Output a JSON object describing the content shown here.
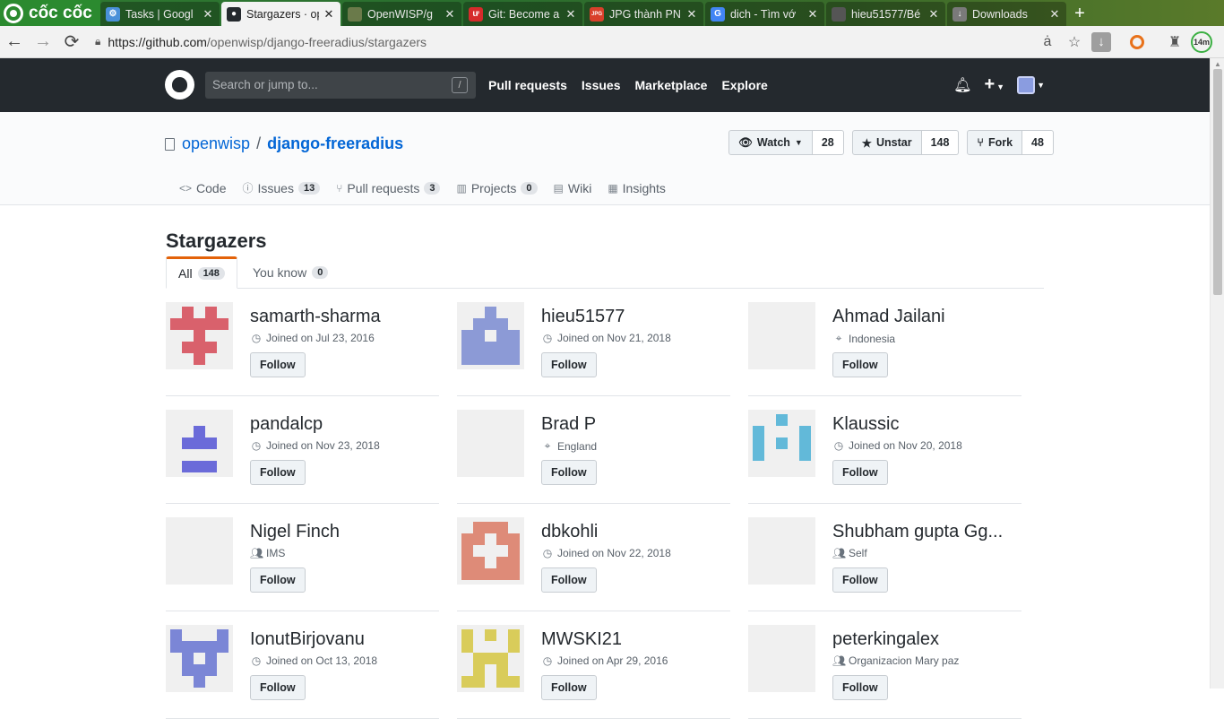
{
  "browser": {
    "brand": "cốc cốc",
    "tabs": [
      {
        "title": "Tasks | Googl",
        "fav_color": "#4a90d9",
        "fav_text": "⚙",
        "active": false
      },
      {
        "title": "Stargazers · op",
        "fav_color": "#24292e",
        "fav_text": "●",
        "active": true
      },
      {
        "title": "OpenWISP/g",
        "fav_color": "#6a7a4a",
        "fav_text": "",
        "active": false
      },
      {
        "title": "Git: Become a",
        "fav_color": "#d62b2b",
        "fav_text": "ư",
        "active": false
      },
      {
        "title": "JPG thành PN",
        "fav_color": "#d9402b",
        "fav_text": "JPG",
        "active": false
      },
      {
        "title": "dich - Tìm vớ",
        "fav_color": "#4285f4",
        "fav_text": "G",
        "active": false
      },
      {
        "title": "hieu51577/Bé",
        "fav_color": "#555555",
        "fav_text": "",
        "active": false
      },
      {
        "title": "Downloads",
        "fav_color": "#7a7a7a",
        "fav_text": "↓",
        "active": false
      }
    ],
    "url_host": "https://github.com",
    "url_path": "/openwisp/django-freeradius/stargazers",
    "translate_glyph": "ȧ",
    "timer_label": "14m"
  },
  "gh": {
    "search_placeholder": "Search or jump to...",
    "search_key": "/",
    "nav": [
      "Pull requests",
      "Issues",
      "Marketplace",
      "Explore"
    ]
  },
  "repo": {
    "owner": "openwisp",
    "separator": "/",
    "name": "django-freeradius",
    "watch_label": "Watch",
    "watch_count": "28",
    "star_label": "Unstar",
    "star_count": "148",
    "fork_label": "Fork",
    "fork_count": "48",
    "nav": [
      {
        "label": "Code",
        "icon": "<>",
        "count": ""
      },
      {
        "label": "Issues",
        "icon": "ⓘ",
        "count": "13"
      },
      {
        "label": "Pull requests",
        "icon": "⑂",
        "count": "3"
      },
      {
        "label": "Projects",
        "icon": "▥",
        "count": "0"
      },
      {
        "label": "Wiki",
        "icon": "▤",
        "count": ""
      },
      {
        "label": "Insights",
        "icon": "▦",
        "count": ""
      }
    ]
  },
  "page": {
    "title": "Stargazers",
    "tab_all": "All",
    "tab_all_count": "148",
    "tab_know": "You know",
    "tab_know_count": "0",
    "follow_label": "Follow"
  },
  "users": [
    {
      "name": "samarth-sharma",
      "meta_icon": "clock",
      "meta": "Joined on Jul 23, 2016",
      "avatar": "identicon",
      "color": "#d9616c",
      "pattern": "a"
    },
    {
      "name": "hieu51577",
      "meta_icon": "clock",
      "meta": "Joined on Nov 21, 2018",
      "avatar": "identicon",
      "color": "#8c9ad6",
      "pattern": "b"
    },
    {
      "name": "Ahmad Jailani",
      "meta_icon": "location",
      "meta": "Indonesia",
      "avatar": "photo-flowers",
      "color": "",
      "pattern": ""
    },
    {
      "name": "pandalcp",
      "meta_icon": "clock",
      "meta": "Joined on Nov 23, 2018",
      "avatar": "identicon",
      "color": "#6b6bd9",
      "pattern": "c"
    },
    {
      "name": "Brad P",
      "meta_icon": "location",
      "meta": "England",
      "avatar": "photo-bear",
      "color": "",
      "pattern": ""
    },
    {
      "name": "Klaussic",
      "meta_icon": "clock",
      "meta": "Joined on Nov 20, 2018",
      "avatar": "identicon",
      "color": "#62b9d9",
      "pattern": "d"
    },
    {
      "name": "Nigel Finch",
      "meta_icon": "org",
      "meta": "IMS",
      "avatar": "photo-nigel",
      "color": "",
      "pattern": ""
    },
    {
      "name": "dbkohli",
      "meta_icon": "clock",
      "meta": "Joined on Nov 22, 2018",
      "avatar": "identicon",
      "color": "#de8b78",
      "pattern": "e"
    },
    {
      "name": "Shubham gupta Gg...",
      "meta_icon": "org",
      "meta": "Self",
      "avatar": "photo-shubham",
      "color": "",
      "pattern": ""
    },
    {
      "name": "IonutBirjovanu",
      "meta_icon": "clock",
      "meta": "Joined on Oct 13, 2018",
      "avatar": "identicon",
      "color": "#7b86d6",
      "pattern": "f"
    },
    {
      "name": "MWSKI21",
      "meta_icon": "clock",
      "meta": "Joined on Apr 29, 2016",
      "avatar": "identicon",
      "color": "#d9cc5a",
      "pattern": "g"
    },
    {
      "name": "peterkingalex",
      "meta_icon": "org",
      "meta": "Organizacion Mary paz",
      "avatar": "photo-peter",
      "color": "",
      "pattern": ""
    }
  ]
}
